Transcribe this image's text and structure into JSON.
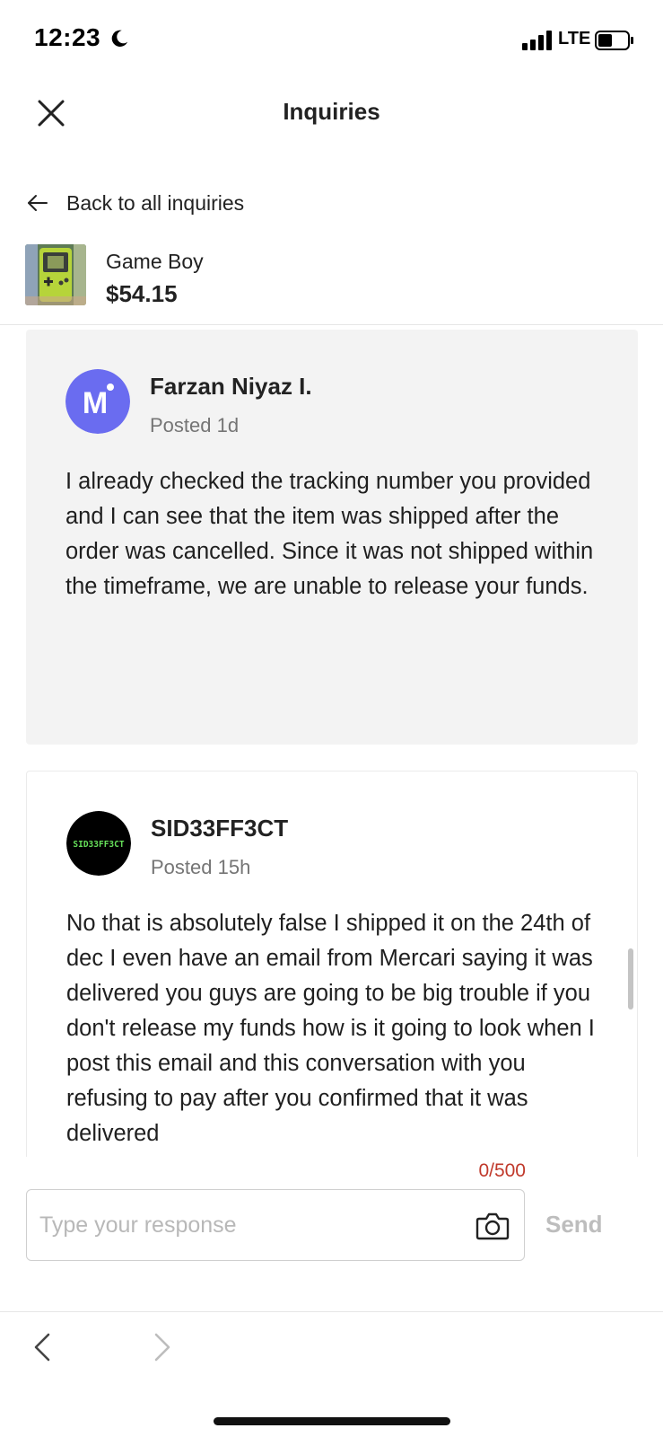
{
  "status_bar": {
    "time": "12:23",
    "network": "LTE"
  },
  "header": {
    "title": "Inquiries",
    "close_icon": "close-icon"
  },
  "back_link": {
    "label": "Back to all inquiries",
    "icon": "arrow-left-icon"
  },
  "item": {
    "name": "Game Boy",
    "price": "$54.15",
    "thumbnail_icon": "game-boy-thumbnail"
  },
  "messages": [
    {
      "author": "Farzan Niyaz I.",
      "posted": "Posted 1d",
      "avatar_letter": "M",
      "avatar_color": "#6a6cf0",
      "body": "I already checked the tracking number you provided and I can see that the item was shipped after the order was cancelled. Since it was not shipped within the timeframe, we are unable to release your funds."
    },
    {
      "author": "SID33FF3CT",
      "posted": "Posted 15h",
      "avatar_text": "SID33FF3CT",
      "avatar_color": "#000000",
      "avatar_text_color": "#66e05a",
      "body": "No that is absolutely false I shipped it on the 24th of dec I even have an email from Mercari saying it was delivered you guys are going to be big trouble if you don't release my funds how is it going to look when I post this email and this conversation with you refusing to pay after you confirmed that it was delivered"
    }
  ],
  "composer": {
    "char_count": "0/500",
    "placeholder": "Type your response",
    "value": "",
    "send_label": "Send",
    "camera_icon": "camera-icon"
  },
  "browser_nav": {
    "back_icon": "chevron-left-icon",
    "forward_icon": "chevron-right-icon"
  },
  "colors": {
    "accent_red": "#c0392b",
    "card_gray": "#f3f3f3",
    "muted_text": "#757575"
  }
}
